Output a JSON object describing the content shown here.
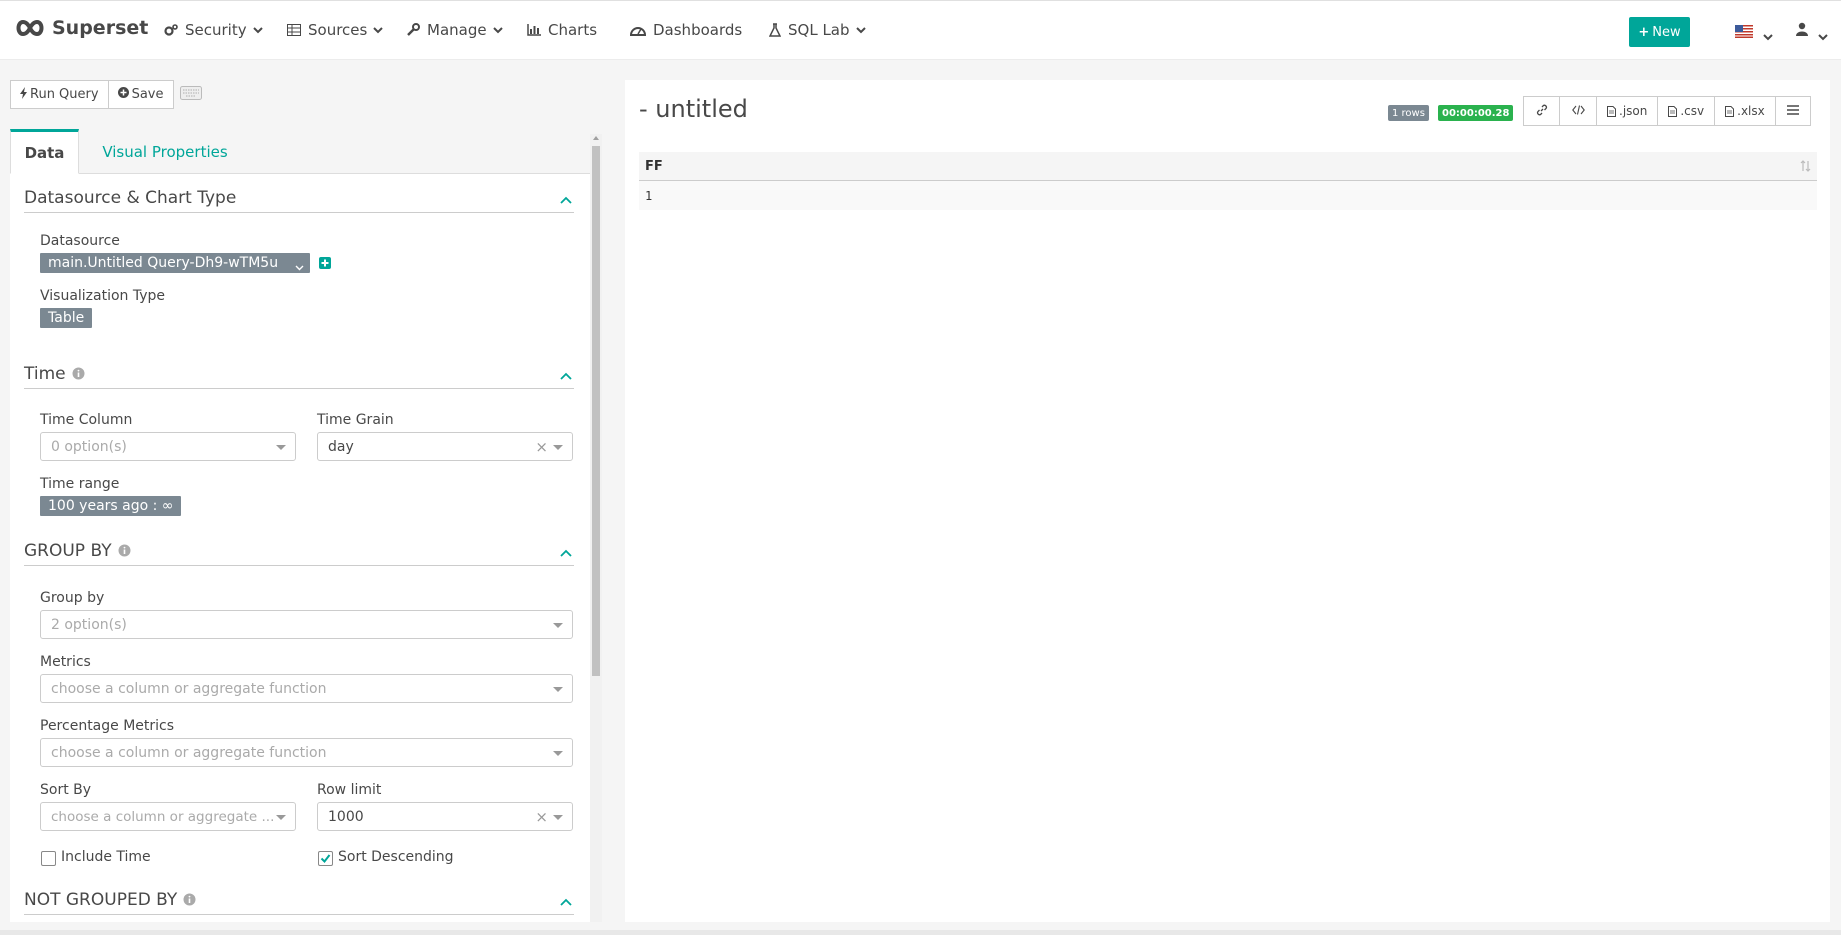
{
  "navbar": {
    "brand": "Superset",
    "items": [
      {
        "label": "Security",
        "icon": "cogs-icon",
        "has_caret": true
      },
      {
        "label": "Sources",
        "icon": "table-icon",
        "has_caret": true
      },
      {
        "label": "Manage",
        "icon": "wrench-icon",
        "has_caret": true
      },
      {
        "label": "Charts",
        "icon": "bar-chart-icon",
        "has_caret": false
      },
      {
        "label": "Dashboards",
        "icon": "dashboard-icon",
        "has_caret": false
      },
      {
        "label": "SQL Lab",
        "icon": "flask-icon",
        "has_caret": true
      }
    ],
    "new_button": "New",
    "accent_color": "#00a699"
  },
  "toolbar": {
    "run_query": "Run Query",
    "save": "Save"
  },
  "tabs": {
    "data": "Data",
    "visual_properties": "Visual Properties"
  },
  "sections": {
    "datasource": {
      "title": "Datasource & Chart Type",
      "datasource_label": "Datasource",
      "datasource_value": "main.Untitled Query-Dh9-wTM5u",
      "viz_type_label": "Visualization Type",
      "viz_type_value": "Table"
    },
    "time": {
      "title": "Time",
      "time_column_label": "Time Column",
      "time_column_placeholder": "0 option(s)",
      "time_grain_label": "Time Grain",
      "time_grain_value": "day",
      "time_range_label": "Time range",
      "time_range_value": "100 years ago : ∞"
    },
    "group_by": {
      "title": "GROUP BY",
      "group_by_label": "Group by",
      "group_by_placeholder": "2 option(s)",
      "metrics_label": "Metrics",
      "metrics_placeholder": "choose a column or aggregate function",
      "percentage_metrics_label": "Percentage Metrics",
      "percentage_metrics_placeholder": "choose a column or aggregate function",
      "sort_by_label": "Sort By",
      "sort_by_placeholder": "choose a column or aggregate ...",
      "row_limit_label": "Row limit",
      "row_limit_value": "1000",
      "include_time_label": "Include Time",
      "include_time_checked": false,
      "sort_descending_label": "Sort Descending",
      "sort_descending_checked": true
    },
    "not_grouped_by": {
      "title": "NOT GROUPED BY"
    }
  },
  "chart": {
    "title": "- untitled",
    "rows_badge": "1 rows",
    "time_badge": "00:00:00.28",
    "export_buttons": [
      ".json",
      ".csv",
      ".xlsx"
    ],
    "table": {
      "columns": [
        "FF"
      ],
      "rows": [
        [
          "1"
        ]
      ]
    }
  }
}
